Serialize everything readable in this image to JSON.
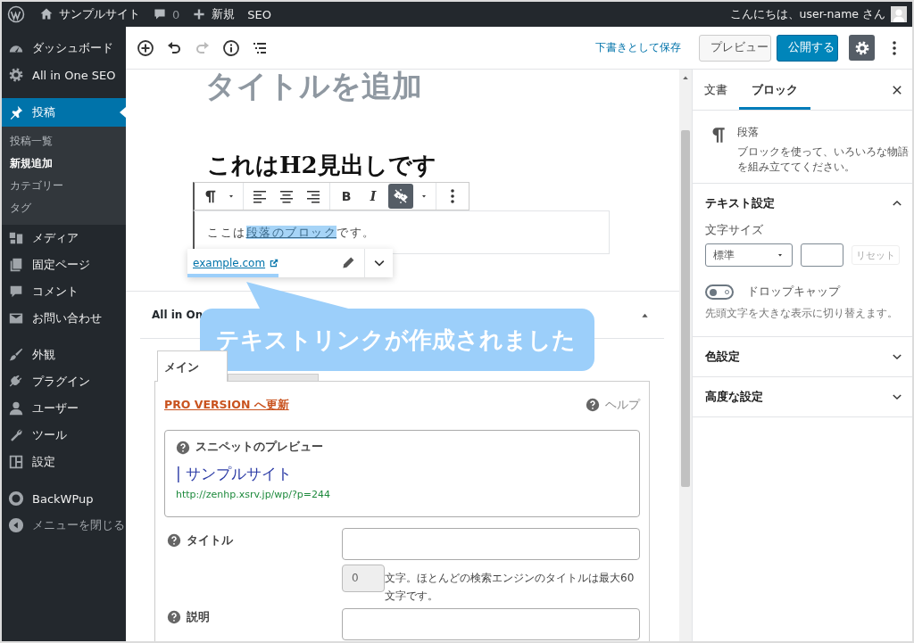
{
  "admin_bar": {
    "site_name": "サンプルサイト",
    "comment_count": "0",
    "new_label": "新規",
    "seo_label": "SEO",
    "greeting": "こんにちは、user-name さん"
  },
  "sidebar": {
    "groups": [
      {
        "items": [
          {
            "label": "ダッシュボード",
            "selected": false
          },
          {
            "label": "All in One SEO",
            "selected": false
          }
        ]
      },
      {
        "items": [
          {
            "label": "投稿",
            "selected": true,
            "children": [
              {
                "label": "投稿一覧",
                "selected": false
              },
              {
                "label": "新規追加",
                "selected": true
              },
              {
                "label": "カテゴリー",
                "selected": false
              },
              {
                "label": "タグ",
                "selected": false
              }
            ]
          },
          {
            "label": "メディア",
            "selected": false
          },
          {
            "label": "固定ページ",
            "selected": false
          },
          {
            "label": "コメント",
            "selected": false
          },
          {
            "label": "お問い合わせ",
            "selected": false
          }
        ]
      },
      {
        "items": [
          {
            "label": "外観",
            "selected": false
          },
          {
            "label": "プラグイン",
            "selected": false
          },
          {
            "label": "ユーザー",
            "selected": false
          },
          {
            "label": "ツール",
            "selected": false
          },
          {
            "label": "設定",
            "selected": false
          }
        ]
      },
      {
        "items": [
          {
            "label": "BackWPup",
            "selected": false
          }
        ]
      }
    ],
    "collapse_label": "メニューを閉じる"
  },
  "header": {
    "save_draft": "下書きとして保存",
    "preview": "プレビュー",
    "publish": "公開する",
    "settings_active": true
  },
  "editor": {
    "title_placeholder": "タイトルを追加",
    "heading": "これはH2見出しです",
    "toolbar": {
      "bold": "B",
      "italic": "I",
      "link_active": true
    },
    "paragraph": {
      "before": "ここは",
      "link": "段落のブロック",
      "after": "です。"
    },
    "link_popover": {
      "url": "example.com"
    },
    "callout": "テキストリンクが作成されました"
  },
  "seo_box": {
    "title": "All in On",
    "tabs": [
      {
        "label": "メイン",
        "selected": true
      },
      {
        "selected": false
      }
    ],
    "pro_link": "PRO VERSION へ更新",
    "help": "ヘルプ",
    "snippet": {
      "heading": "スニペットのプレビュー",
      "title": "| サンプルサイト",
      "url": "http://zenhp.xsrv.jp/wp/?p=244"
    },
    "fields": [
      {
        "label": "タイトル",
        "counter": "0",
        "note": "文字。ほとんどの検索エンジンのタイトルは最大60文字です。"
      },
      {
        "label": "説明"
      }
    ]
  },
  "settings_panel": {
    "tabs": [
      {
        "label": "文書",
        "selected": false
      },
      {
        "label": "ブロック",
        "selected": true
      }
    ],
    "block": {
      "name": "段落",
      "description": "ブロックを使って、いろいろな物語を組み立ててください。"
    },
    "sections": [
      {
        "title": "テキスト設定",
        "expanded": true,
        "font_size_label": "文字サイズ",
        "font_size": "標準",
        "reset": "リセット",
        "reset_disabled": true,
        "drop_cap": {
          "label": "ドロップキャップ",
          "on": false,
          "help": "先頭文字を大きな表示に切り替えます。"
        }
      },
      {
        "title": "色設定",
        "expanded": false
      },
      {
        "title": "高度な設定",
        "expanded": false
      }
    ]
  }
}
